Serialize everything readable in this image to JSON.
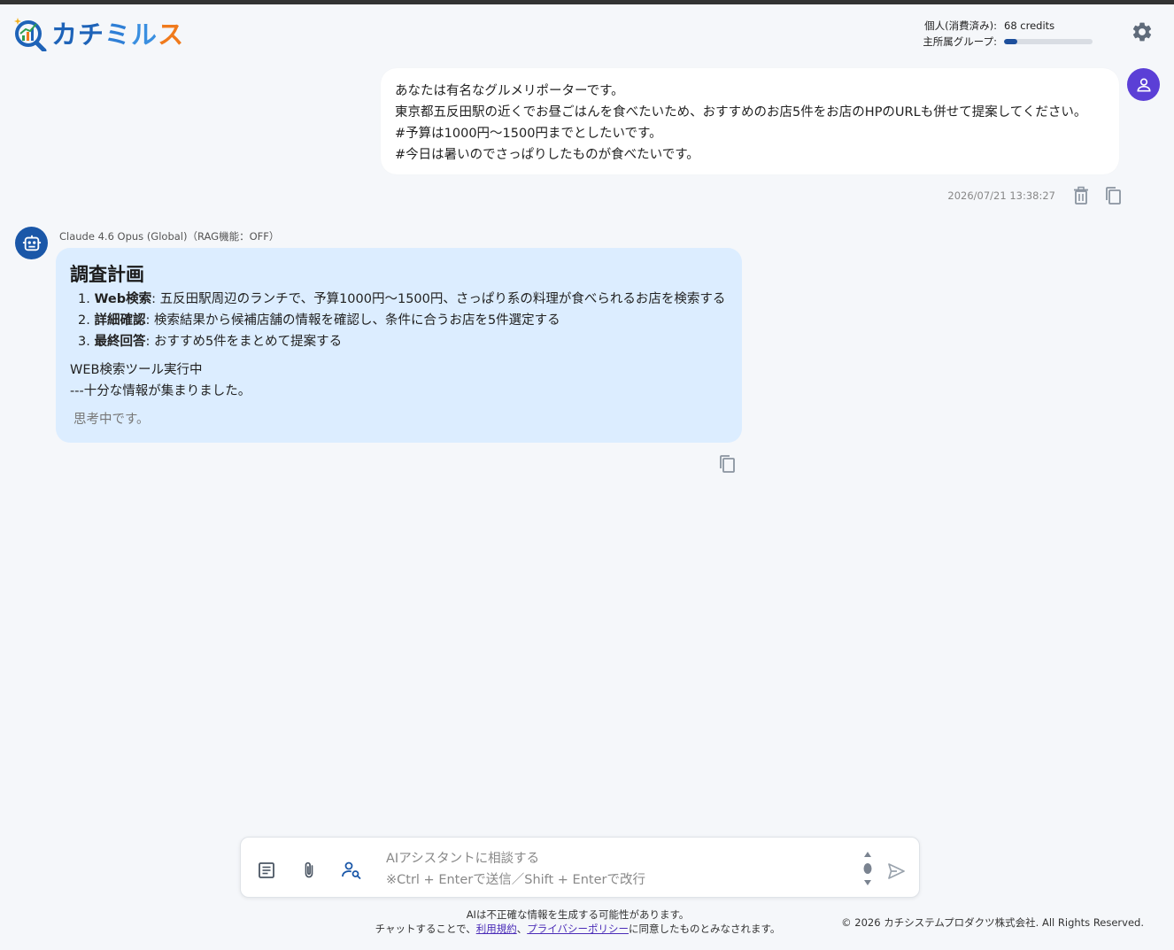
{
  "header": {
    "logo_text": [
      "カ",
      "チ",
      "ミ",
      "ル",
      "ス"
    ],
    "credits": {
      "personal_label": "個人(消費済み):",
      "personal_value": "68 credits",
      "group_label": "主所属グループ:",
      "group_usage_percent": 15
    }
  },
  "user_message": {
    "lines": [
      "あなたは有名なグルメリポーターです。",
      "東京都五反田駅の近くでお昼ごはんを食べたいため、おすすめのお店5件をお店のHPのURLも併せて提案してください。",
      "#予算は1000円〜1500円までとしたいです。",
      "#今日は暑いのでさっぱりしたものが食べたいです。"
    ],
    "timestamp": "2026/07/21 13:38:27"
  },
  "bot_message": {
    "model": "Claude 4.6 Opus (Global)（RAG機能：OFF）",
    "heading": "調査計画",
    "plan": [
      {
        "num": "1.",
        "title": "Web検索",
        "text": ": 五反田駅周辺のランチで、予算1000円〜1500円、さっぱり系の料理が食べられるお店を検索する"
      },
      {
        "num": "2.",
        "title": "詳細確認",
        "text": ": 検索結果から候補店舗の情報を確認し、条件に合うお店を5件選定する"
      },
      {
        "num": "3.",
        "title": "最終回答",
        "text": ": おすすめ5件をまとめて提案する"
      }
    ],
    "tool_status": "WEB検索ツール実行中",
    "tool_result": "---十分な情報が集まりました。",
    "thinking": "思考中です。"
  },
  "input": {
    "placeholder": "AIアシスタントに相談する\n※Ctrl + Enterで送信／Shift + Enterで改行"
  },
  "footer": {
    "disclaimer_line1": "AIは不正確な情報を生成する可能性があります。",
    "disclaimer_pre": "チャットすることで、",
    "terms_link": "利用規約",
    "separator": "、",
    "privacy_link": "プライバシーポリシー",
    "disclaimer_post": "に同意したものとみなされます。",
    "copyright": "© 2026 カチシステムプロダクツ株式会社. All Rights Reserved."
  },
  "colors": {
    "user_avatar": "#5b3fd6",
    "bot_avatar": "#1a57a8",
    "bot_bubble": "#dcedff",
    "logo_orange": "#f07a1c",
    "logo_blue": "#1e63b8"
  }
}
